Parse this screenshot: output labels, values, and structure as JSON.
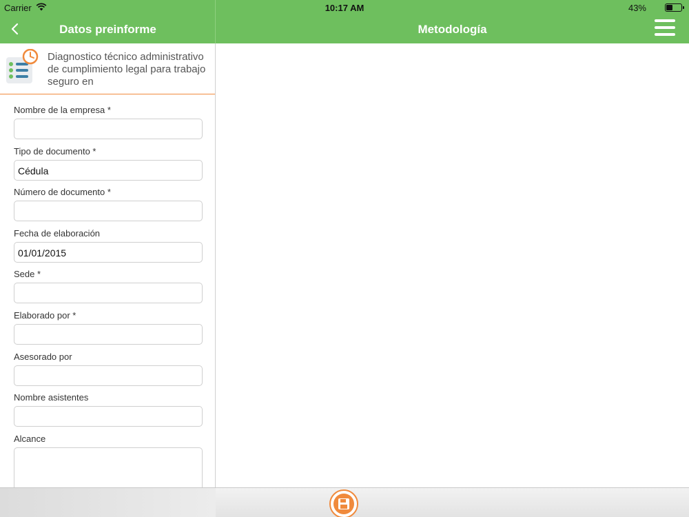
{
  "status_bar": {
    "carrier": "Carrier",
    "time": "10:17 AM",
    "battery": "43%"
  },
  "nav": {
    "left_title": "Datos preinforme",
    "right_title": "Metodología"
  },
  "document": {
    "title": "Diagnostico técnico administrativo de cumplimiento legal para trabajo seguro en"
  },
  "form": {
    "fields": [
      {
        "label": "Nombre de la empresa *",
        "value": ""
      },
      {
        "label": "Tipo de documento *",
        "value": "Cédula"
      },
      {
        "label": "Número de documento *",
        "value": ""
      },
      {
        "label": "Fecha de elaboración",
        "value": "01/01/2015"
      },
      {
        "label": "Sede *",
        "value": ""
      },
      {
        "label": "Elaborado por *",
        "value": ""
      },
      {
        "label": "Asesorado por",
        "value": ""
      },
      {
        "label": "Nombre asistentes",
        "value": ""
      },
      {
        "label": "Alcance",
        "value": ""
      }
    ]
  },
  "icons": {
    "back": "chevron-left-icon",
    "menu": "hamburger-menu-icon",
    "document": "checklist-clock-icon",
    "save": "floppy-disk-icon",
    "wifi": "wifi-icon",
    "battery": "battery-icon"
  },
  "colors": {
    "header_green": "#6ebf5e",
    "accent_orange": "#f08a3c",
    "icon_blue": "#3d7fa6",
    "icon_green": "#6ebf5e"
  }
}
